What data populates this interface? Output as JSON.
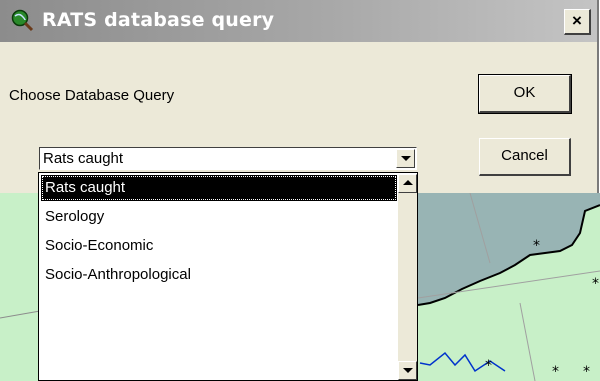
{
  "dialog": {
    "title": "RATS database query",
    "close_label": "×",
    "prompt": "Choose Database Query",
    "ok_label": "OK",
    "cancel_label": "Cancel"
  },
  "query_select": {
    "value": "Rats caught",
    "options": [
      "Rats caught",
      "Serology",
      "Socio-Economic",
      "Socio-Anthropological"
    ],
    "selected_index": 0
  },
  "icons": {
    "app": "globe-search-icon",
    "combo_arrow": "chevron-down-icon",
    "scroll_up": "arrow-up-icon",
    "scroll_down": "arrow-down-icon"
  },
  "colors": {
    "map_land": "#c8f0c8",
    "map_water": "#98b4b4",
    "selection": "#000000"
  }
}
